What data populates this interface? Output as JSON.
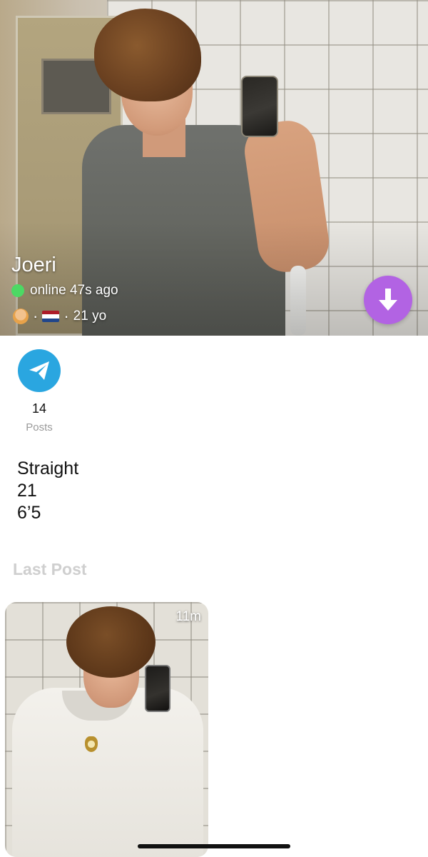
{
  "profile": {
    "name": "Joeri",
    "status": "online 47s ago",
    "age": "21 yo",
    "separator": "·",
    "avatar_icon": "person-emoji-icon",
    "flag_icon": "netherlands-flag-icon"
  },
  "actions": {
    "download_icon": "arrow-down-icon",
    "telegram_icon": "paper-plane-icon"
  },
  "stats": {
    "posts_count": "14",
    "posts_label": "Posts"
  },
  "bio": {
    "line1": "Straight",
    "line2": "21",
    "line3": "6’5"
  },
  "last_post": {
    "title": "Last Post",
    "time": "11m"
  },
  "colors": {
    "online_dot": "#4cd964",
    "download_button": "#b263e3",
    "telegram_button": "#2aa6e0",
    "section_title": "#cfcfcf"
  }
}
